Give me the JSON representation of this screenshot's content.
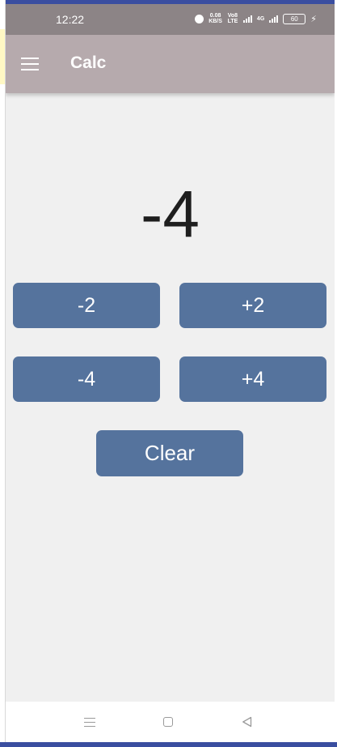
{
  "status_bar": {
    "time": "12:22",
    "net_speed_value": "0.08",
    "net_speed_unit": "KB/S",
    "volte": "Vo8 LTE",
    "net_type": "4G",
    "battery": "60"
  },
  "app_bar": {
    "title": "Calc",
    "menu_icon": "hamburger-menu-icon"
  },
  "display": {
    "value": "-4"
  },
  "buttons": {
    "minus2": "-2",
    "plus2": "+2",
    "minus4": "-4",
    "plus4": "+4",
    "clear": "Clear"
  },
  "nav_bar": {
    "icons": [
      "recents-icon",
      "home-icon",
      "back-icon"
    ]
  },
  "colors": {
    "status_bar": "#8c8486",
    "app_bar": "#b6aaad",
    "button": "#55739d",
    "background": "#f0f0f0"
  }
}
